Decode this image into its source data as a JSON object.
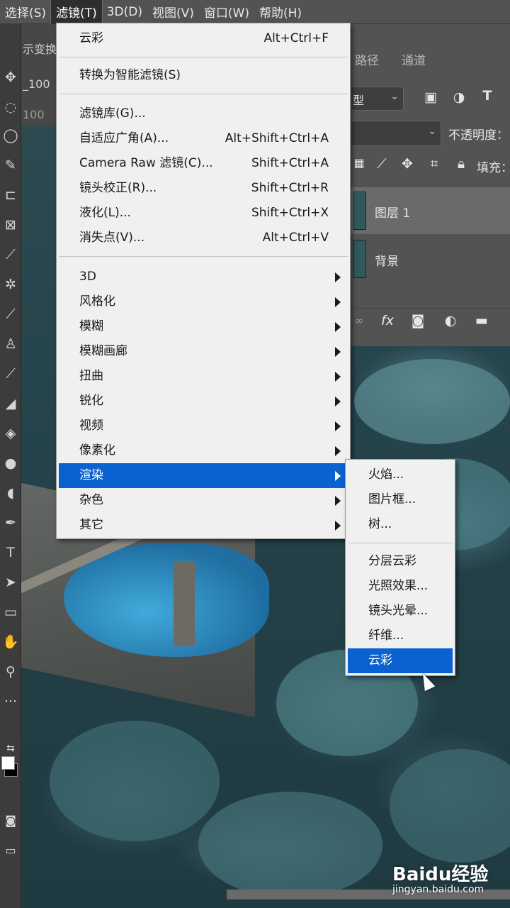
{
  "menubar": [
    "选择(S)",
    "滤镜(T)",
    "3D(D)",
    "视图(V)",
    "窗口(W)",
    "帮助(H)"
  ],
  "doc": {
    "tab_fragment": "示变换",
    "zoom_a": "_100",
    "zoom_b": "100"
  },
  "panel": {
    "tabs": [
      "路径",
      "通道"
    ],
    "kind_fragment": "型",
    "opacity_label": "不透明度：",
    "fill_label": "填充：",
    "layers": [
      {
        "name": "图层 1"
      },
      {
        "name": "背景"
      }
    ],
    "fx_label": "fx"
  },
  "filter_menu": {
    "items": [
      {
        "label": "云彩",
        "shortcut": "Alt+Ctrl+F"
      },
      {
        "label": "转换为智能滤镜(S)",
        "shortcut": ""
      },
      {
        "label": "滤镜库(G)...",
        "shortcut": ""
      },
      {
        "label": "自适应广角(A)...",
        "shortcut": "Alt+Shift+Ctrl+A"
      },
      {
        "label": "Camera Raw 滤镜(C)...",
        "shortcut": "Shift+Ctrl+A"
      },
      {
        "label": "镜头校正(R)...",
        "shortcut": "Shift+Ctrl+R"
      },
      {
        "label": "液化(L)...",
        "shortcut": "Shift+Ctrl+X"
      },
      {
        "label": "消失点(V)...",
        "shortcut": "Alt+Ctrl+V"
      },
      {
        "label": "3D",
        "shortcut": ""
      },
      {
        "label": "风格化",
        "shortcut": ""
      },
      {
        "label": "模糊",
        "shortcut": ""
      },
      {
        "label": "模糊画廊",
        "shortcut": ""
      },
      {
        "label": "扭曲",
        "shortcut": ""
      },
      {
        "label": "锐化",
        "shortcut": ""
      },
      {
        "label": "视频",
        "shortcut": ""
      },
      {
        "label": "像素化",
        "shortcut": ""
      },
      {
        "label": "渲染",
        "shortcut": ""
      },
      {
        "label": "杂色",
        "shortcut": ""
      },
      {
        "label": "其它",
        "shortcut": ""
      }
    ]
  },
  "render_submenu": [
    "火焰...",
    "图片框...",
    "树...",
    "分层云彩",
    "光照效果...",
    "镜头光晕...",
    "纤维...",
    "云彩"
  ],
  "watermark": {
    "brand": "Bai⁠du经验",
    "url": "jingyan.baidu.com"
  },
  "colors": {
    "menu_bg": "#f0f0f0",
    "highlight": "#0a62d0",
    "chrome": "#535353"
  }
}
